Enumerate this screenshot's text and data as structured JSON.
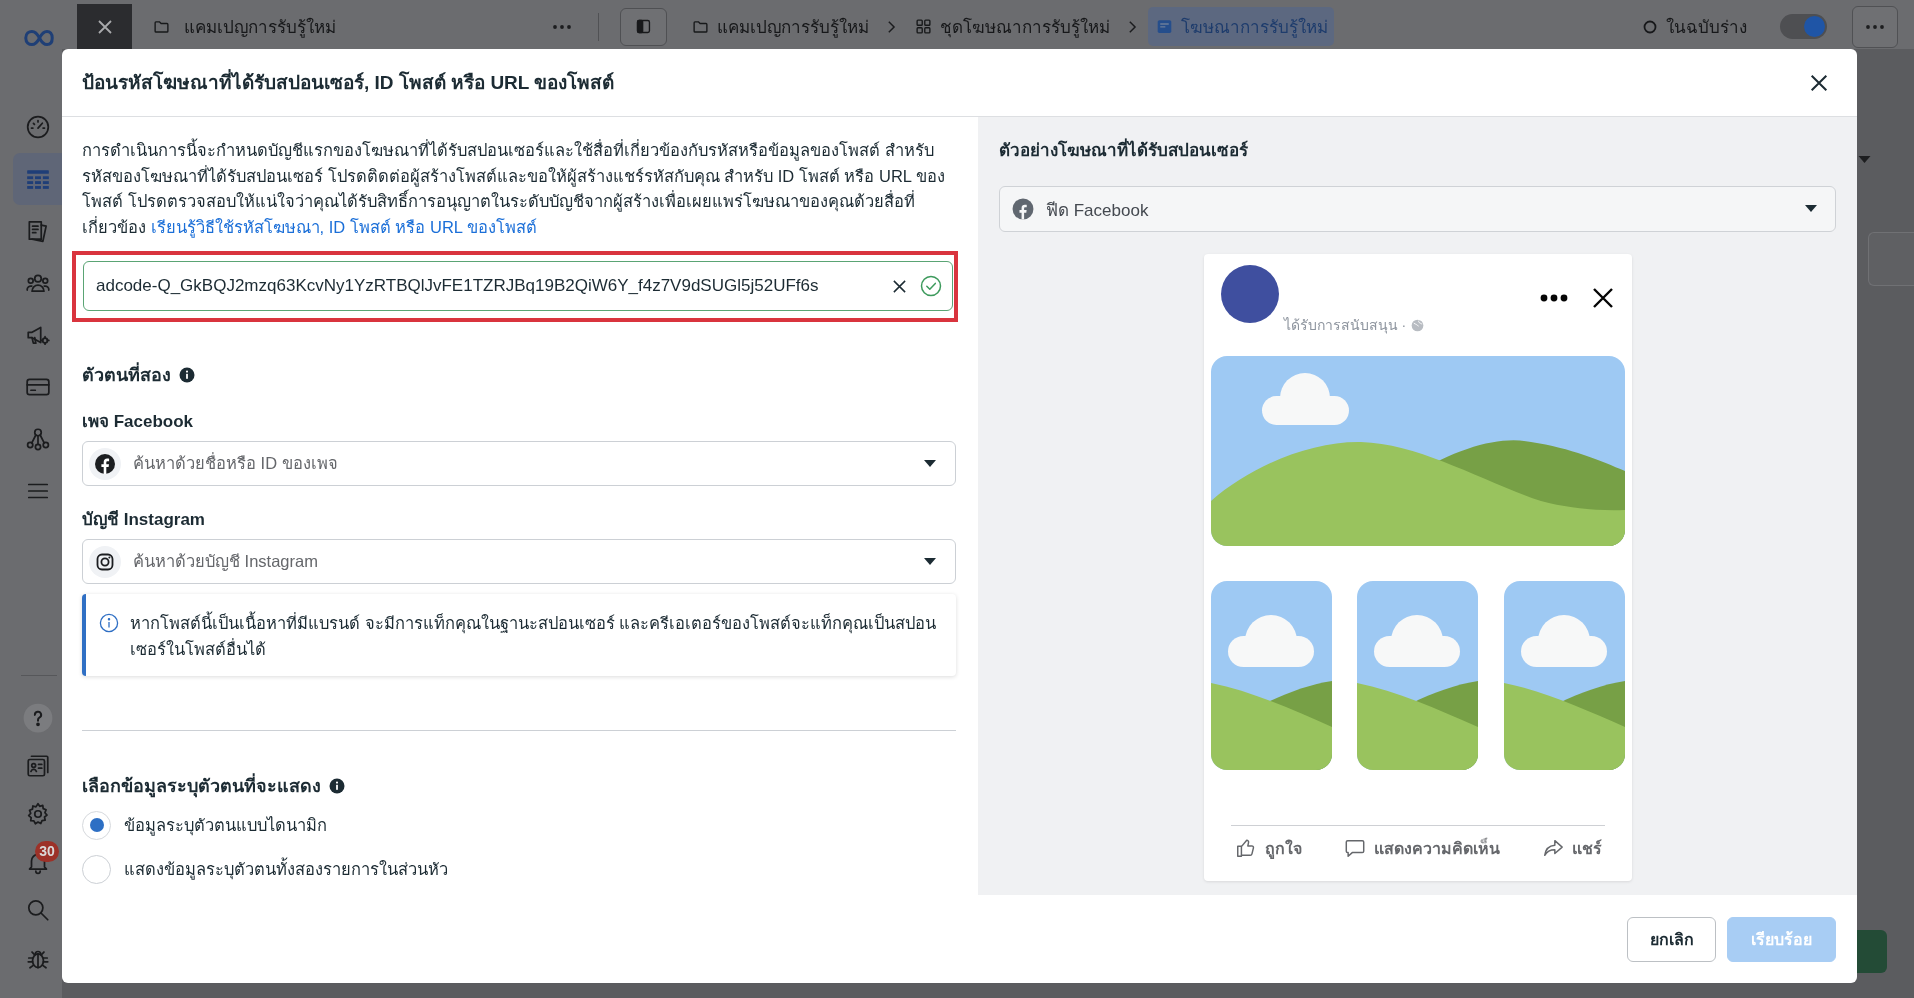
{
  "sidebar": {
    "top_items": [
      {
        "selected": false
      },
      {
        "selected": true
      },
      {
        "selected": false
      },
      {
        "selected": false
      },
      {
        "selected": false
      },
      {
        "selected": false
      },
      {
        "selected": false
      },
      {
        "selected": false
      }
    ],
    "notification_badge": "30"
  },
  "top_bar": {
    "tab_title": "แคมเปญการรับรู้ใหม่",
    "breadcrumbs": [
      {
        "kind": "campaign",
        "label": "แคมเปญการรับรู้ใหม่",
        "selected": false
      },
      {
        "kind": "ad_set",
        "label": "ชุดโฆษณาการรับรู้ใหม่",
        "selected": false
      },
      {
        "kind": "ad",
        "label": "โฆษณาการรับรู้ใหม่",
        "selected": true
      }
    ],
    "status": "ในฉบับร่าง",
    "toggle": {
      "on": true
    }
  },
  "dialog": {
    "title": "ป้อนรหัสโฆษณาที่ได้รับสปอนเซอร์, ID โพสต์ หรือ URL ของโพสต์",
    "intro": {
      "text": "การดำเนินการนี้จะกำหนดบัญชีแรกของโฆษณาที่ได้รับสปอนเซอร์และใช้สื่อที่เกี่ยวข้องกับรหัสหรือข้อมูลของโพสต์ สำหรับรหัสของโฆษณาที่ได้รับสปอนเซอร์ โปรดติดต่อผู้สร้างโพสต์และขอให้ผู้สร้างแชร์รหัสกับคุณ สำหรับ ID โพสต์ หรือ URL ของโพสต์ โปรดตรวจสอบให้แน่ใจว่าคุณได้รับสิทธิ์การอนุญาตในระดับบัญชีจากผู้สร้างเพื่อเผยแพร่โฆษณาของคุณด้วยสื่อที่เกี่ยวข้อง",
      "link": "เรียนรู้วิธีใช้รหัสโฆษณา, ID โพสต์ หรือ URL ของโพสต์"
    },
    "code_field": {
      "value": "adcode-Q_GkBQJ2mzq63KcvNy1YzRTBQlJvFE1TZRJBq19B2QiW6Y_f4z7V9dSUGl5j52UFf6s",
      "valid": true
    },
    "secondary_identity": {
      "heading": "ตัวตนที่สอง",
      "fields": [
        {
          "kind": "facebook_page",
          "label": "เพจ Facebook",
          "placeholder": "ค้นหาด้วยชื่อหรือ ID ของเพจ"
        },
        {
          "kind": "instagram_account",
          "label": "บัญชี Instagram",
          "placeholder": "ค้นหาด้วยบัญชี Instagram"
        }
      ],
      "notice": "หากโพสต์นี้เป็นเนื้อหาที่มีแบรนด์ จะมีการแท็กคุณในฐานะสปอนเซอร์ และครีเอเตอร์ของโพสต์จะแท็กคุณเป็นสปอนเซอร์ในโพสต์อื่นได้"
    },
    "identity_display": {
      "heading": "เลือกข้อมูลระบุตัวตนที่จะแสดง",
      "options": [
        {
          "label": "ข้อมูลระบุตัวตนแบบไดนามิก",
          "selected": true
        },
        {
          "label": "แสดงข้อมูลระบุตัวตนทั้งสองรายการในส่วนหัว",
          "selected": false
        }
      ]
    },
    "preview": {
      "heading": "ตัวอย่างโฆษณาที่ได้รับสปอนเซอร์",
      "placement": "ฟีด Facebook",
      "post": {
        "sponsored_label": "ได้รับการสนับสนุน ·",
        "actions": [
          {
            "kind": "like",
            "label": "ถูกใจ"
          },
          {
            "kind": "comment",
            "label": "แสดงความคิดเห็น"
          },
          {
            "kind": "share",
            "label": "แชร์"
          }
        ]
      }
    },
    "buttons": [
      {
        "kind": "cancel",
        "label": "ยกเลิก",
        "disabled": false
      },
      {
        "kind": "confirm",
        "label": "เรียบร้อย",
        "disabled": true
      }
    ]
  }
}
